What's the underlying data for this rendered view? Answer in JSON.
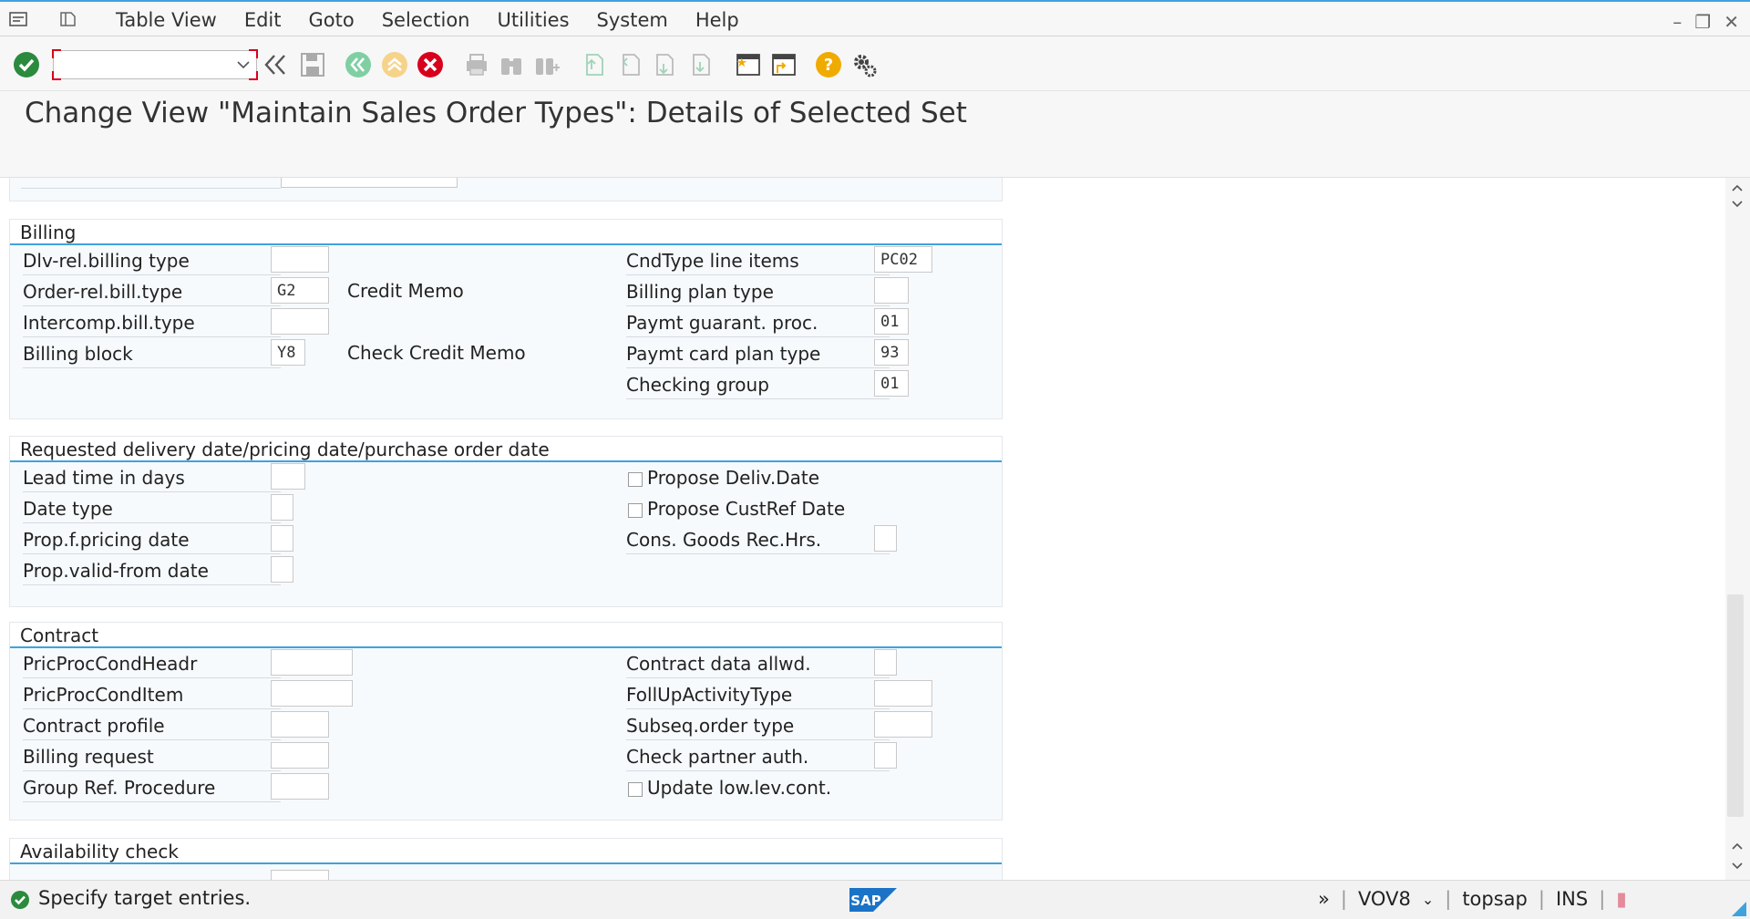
{
  "menu": {
    "items": [
      "Table View",
      "Edit",
      "Goto",
      "Selection",
      "Utilities",
      "System",
      "Help"
    ]
  },
  "toolbar": {
    "command_value": ""
  },
  "title": "Change View \"Maintain Sales Order Types\": Details of Selected Set",
  "billing": {
    "header": "Billing",
    "dlv_rel_billing_type": {
      "label": "Dlv-rel.billing type",
      "value": ""
    },
    "order_rel_bill_type": {
      "label": "Order-rel.bill.type",
      "value": "G2",
      "desc": "Credit Memo"
    },
    "intercomp_bill_type": {
      "label": "Intercomp.bill.type",
      "value": ""
    },
    "billing_block": {
      "label": "Billing block",
      "value": "Y8",
      "desc": "Check Credit Memo"
    },
    "cndtype_line_items": {
      "label": "CndType line items",
      "value": "PC02"
    },
    "billing_plan_type": {
      "label": "Billing plan type",
      "value": ""
    },
    "paymt_guarant_proc": {
      "label": "Paymt guarant. proc.",
      "value": "01"
    },
    "paymt_card_plan_type": {
      "label": "Paymt card plan type",
      "value": "93"
    },
    "checking_group": {
      "label": "Checking group",
      "value": "01"
    }
  },
  "reqdate": {
    "header": "Requested delivery date/pricing date/purchase order date",
    "lead_time": {
      "label": "Lead time in days",
      "value": ""
    },
    "date_type": {
      "label": "Date type",
      "value": ""
    },
    "prop_pricing_date": {
      "label": "Prop.f.pricing date",
      "value": ""
    },
    "prop_valid_from": {
      "label": "Prop.valid-from date",
      "value": ""
    },
    "propose_deliv_date": {
      "label": "Propose Deliv.Date",
      "checked": false
    },
    "propose_custref_date": {
      "label": "Propose CustRef Date",
      "checked": false
    },
    "cons_goods_rec_hrs": {
      "label": "Cons. Goods Rec.Hrs.",
      "value": ""
    }
  },
  "contract": {
    "header": "Contract",
    "pricproc_head": {
      "label": "PricProcCondHeadr",
      "value": ""
    },
    "pricproc_item": {
      "label": "PricProcCondItem",
      "value": ""
    },
    "contract_profile": {
      "label": "Contract profile",
      "value": ""
    },
    "billing_request": {
      "label": "Billing request",
      "value": ""
    },
    "group_ref_procedure": {
      "label": "Group Ref. Procedure",
      "value": ""
    },
    "contract_data_allwd": {
      "label": "Contract data allwd.",
      "value": ""
    },
    "follup_activity_type": {
      "label": "FollUpActivityType",
      "value": ""
    },
    "subseq_order_type": {
      "label": "Subseq.order type",
      "value": ""
    },
    "check_partner_auth": {
      "label": "Check partner auth.",
      "value": ""
    },
    "update_low_lev_cont": {
      "label": "Update low.lev.cont.",
      "checked": false
    }
  },
  "availability": {
    "header": "Availability check"
  },
  "status": {
    "message": "Specify target entries.",
    "transaction": "VOV8",
    "server": "topsap",
    "mode": "INS",
    "logo": "SAP"
  },
  "colors": {
    "accent": "#3fa2dd",
    "ok_green": "#2b8a3e",
    "cancel_red": "#d9001b",
    "help_yellow": "#f0ab00"
  }
}
